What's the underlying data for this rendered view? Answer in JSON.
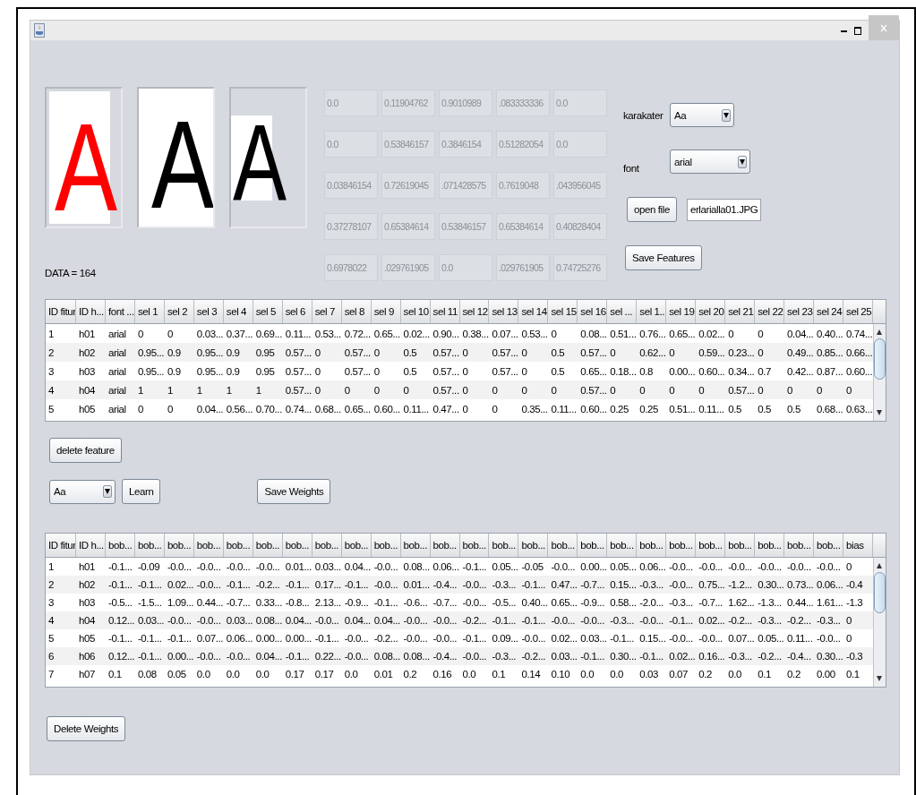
{
  "previews": [
    {
      "kind": "padded",
      "letter": "A",
      "color": "#ff0000"
    },
    {
      "kind": "full",
      "letter": "A",
      "color": "#000000"
    },
    {
      "kind": "cropped",
      "letter": "A",
      "color": "#000000"
    }
  ],
  "data_count": "DATA = 164",
  "feature_values": [
    [
      "0.0",
      "0.11904762",
      "0.9010989",
      ".083333336",
      "0.0"
    ],
    [
      "0.0",
      "0.53846157",
      "0.3846154",
      "0.51282054",
      "0.0"
    ],
    [
      "0.03846154",
      "0.72619045",
      ".071428575",
      "0.7619048",
      ".043956045"
    ],
    [
      "0.37278107",
      "0.65384614",
      "0.53846157",
      "0.65384614",
      "0.40828404"
    ],
    [
      "0.6978022",
      ".029761905",
      "0.0",
      ".029761905",
      "0.74725276"
    ]
  ],
  "karakater": {
    "label": "karakater",
    "value": "Aa"
  },
  "font": {
    "label": "font",
    "value": "arial"
  },
  "open_file": {
    "button": "open file",
    "value": "erlarialla01.JPG"
  },
  "save_features": "Save Features",
  "features_table": {
    "columns": [
      "ID fitur",
      "ID h...",
      "font ...",
      "sel 1",
      "sel 2",
      "sel 3",
      "sel 4",
      "sel 5",
      "sel 6",
      "sel 7",
      "sel 8",
      "sel 9",
      "sel 10",
      "sel 11",
      "sel 12",
      "sel 13",
      "sel 14",
      "sel 15",
      "sel 16",
      "sel ...",
      "sel 1...",
      "sel 19",
      "sel 20",
      "sel 21",
      "sel 22",
      "sel 23",
      "sel 24",
      "sel 25"
    ],
    "rows": [
      [
        "1",
        "h01",
        "arial",
        "0",
        "0",
        "0.03...",
        "0.37...",
        "0.69...",
        "0.11...",
        "0.53...",
        "0.72...",
        "0.65...",
        "0.02...",
        "0.90...",
        "0.38...",
        "0.07...",
        "0.53...",
        "0",
        "0.08...",
        "0.51...",
        "0.76...",
        "0.65...",
        "0.02...",
        "0",
        "0",
        "0.04...",
        "0.40...",
        "0.74..."
      ],
      [
        "2",
        "h02",
        "arial",
        "0.95...",
        "0.9",
        "0.95...",
        "0.9",
        "0.95",
        "0.57...",
        "0",
        "0.57...",
        "0",
        "0.5",
        "0.57...",
        "0",
        "0.57...",
        "0",
        "0.5",
        "0.57...",
        "0",
        "0.62...",
        "0",
        "0.59...",
        "0.23...",
        "0",
        "0.49...",
        "0.85...",
        "0.66..."
      ],
      [
        "3",
        "h03",
        "arial",
        "0.95...",
        "0.9",
        "0.95...",
        "0.9",
        "0.95",
        "0.57...",
        "0",
        "0.57...",
        "0",
        "0.5",
        "0.57...",
        "0",
        "0.57...",
        "0",
        "0.5",
        "0.65...",
        "0.18...",
        "0.8",
        "0.00...",
        "0.60...",
        "0.34...",
        "0.7",
        "0.42...",
        "0.87...",
        "0.60..."
      ],
      [
        "4",
        "h04",
        "arial",
        "1",
        "1",
        "1",
        "1",
        "1",
        "0.57...",
        "0",
        "0",
        "0",
        "0",
        "0.57...",
        "0",
        "0",
        "0",
        "0",
        "0.57...",
        "0",
        "0",
        "0",
        "0",
        "0.57...",
        "0",
        "0",
        "0",
        "0"
      ],
      [
        "5",
        "h05",
        "arial",
        "0",
        "0",
        "0.04...",
        "0.56...",
        "0.70...",
        "0.74...",
        "0.68...",
        "0.65...",
        "0.60...",
        "0.11...",
        "0.47...",
        "0",
        "0",
        "0.35...",
        "0.11...",
        "0.60...",
        "0.25",
        "0.25",
        "0.51...",
        "0.11...",
        "0.5",
        "0.5",
        "0.5",
        "0.68...",
        "0.63..."
      ]
    ]
  },
  "delete_feature": "delete feature",
  "learn_combo": "Aa",
  "learn": "Learn",
  "save_weights": "Save Weights",
  "weights_table": {
    "columns": [
      "ID fitur",
      "ID h...",
      "bob...",
      "bob...",
      "bob...",
      "bob...",
      "bob...",
      "bob...",
      "bob...",
      "bob...",
      "bob...",
      "bob...",
      "bob...",
      "bob...",
      "bob...",
      "bob...",
      "bob...",
      "bob...",
      "bob...",
      "bob...",
      "bob...",
      "bob...",
      "bob...",
      "bob...",
      "bob...",
      "bob...",
      "bob...",
      "bias"
    ],
    "rows": [
      [
        "1",
        "h01",
        "-0.1...",
        "-0.09",
        "-0.0...",
        "-0.0...",
        "-0.0...",
        "-0.0...",
        "0.01...",
        "0.03...",
        "0.04...",
        "-0.0...",
        "0.08...",
        "0.06...",
        "-0.1...",
        "0.05...",
        "-0.05",
        "-0.0...",
        "0.00...",
        "0.05...",
        "0.06...",
        "-0.0...",
        "-0.0...",
        "-0.0...",
        "-0.0...",
        "-0.0...",
        "-0.0...",
        "0"
      ],
      [
        "2",
        "h02",
        "-0.1...",
        "-0.1...",
        "0.02...",
        "-0.0...",
        "-0.1...",
        "-0.2...",
        "-0.1...",
        "0.17...",
        "-0.1...",
        "-0.0...",
        "0.01...",
        "-0.4...",
        "-0.0...",
        "-0.3...",
        "-0.1...",
        "0.47...",
        "-0.7...",
        "0.15...",
        "-0.3...",
        "-0.0...",
        "0.75...",
        "-1.2...",
        "0.30...",
        "0.73...",
        "0.06...",
        "-0.4"
      ],
      [
        "3",
        "h03",
        "-0.5...",
        "-1.5...",
        "1.09...",
        "0.44...",
        "-0.7...",
        "0.33...",
        "-0.8...",
        "2.13...",
        "-0.9...",
        "-0.1...",
        "-0.6...",
        "-0.7...",
        "-0.0...",
        "-0.5...",
        "0.40...",
        "0.65...",
        "-0.9...",
        "0.58...",
        "-2.0...",
        "-0.3...",
        "-0.7...",
        "1.62...",
        "-1.3...",
        "0.44...",
        "1.61...",
        "-1.3"
      ],
      [
        "4",
        "h04",
        "0.12...",
        "0.03...",
        "-0.0...",
        "-0.0...",
        "0.03...",
        "0.08...",
        "0.04...",
        "-0.0...",
        "0.04...",
        "0.04...",
        "-0.0...",
        "-0.0...",
        "-0.2...",
        "-0.1...",
        "-0.1...",
        "-0.0...",
        "-0.0...",
        "-0.3...",
        "-0.0...",
        "-0.1...",
        "0.02...",
        "-0.2...",
        "-0.3...",
        "-0.2...",
        "-0.3...",
        "0"
      ],
      [
        "5",
        "h05",
        "-0.1...",
        "-0.1...",
        "-0.1...",
        "0.07...",
        "0.06...",
        "0.00...",
        "0.00...",
        "-0.1...",
        "-0.0...",
        "-0.2...",
        "-0.0...",
        "-0.0...",
        "-0.1...",
        "0.09...",
        "-0.0...",
        "0.02...",
        "0.03...",
        "-0.1...",
        "0.15...",
        "-0.0...",
        "-0.0...",
        "0.07...",
        "0.05...",
        "0.11...",
        "-0.0...",
        "0"
      ],
      [
        "6",
        "h06",
        "0.12...",
        "-0.1...",
        "0.00...",
        "-0.0...",
        "-0.0...",
        "0.04...",
        "-0.1...",
        "0.22...",
        "-0.0...",
        "0.08...",
        "0.08...",
        "-0.4...",
        "-0.0...",
        "-0.3...",
        "-0.2...",
        "0.03...",
        "-0.1...",
        "0.30...",
        "-0.1...",
        "0.02...",
        "0.16...",
        "-0.3...",
        "-0.2...",
        "-0.4...",
        "0.30...",
        "-0.3"
      ],
      [
        "7",
        "h07",
        "0.1",
        "0.08",
        "0.05",
        "0.0",
        "0.0",
        "0.0",
        "0.17",
        "0.17",
        "0.0",
        "0.01",
        "0.2",
        "0.16",
        "0.0",
        "0.1",
        "0.14",
        "0.10",
        "0.0",
        "0.0",
        "0.03",
        "0.07",
        "0.2",
        "0.0",
        "0.1",
        "0.2",
        "0.00",
        "0.1"
      ]
    ]
  },
  "delete_weights": "Delete Weights"
}
